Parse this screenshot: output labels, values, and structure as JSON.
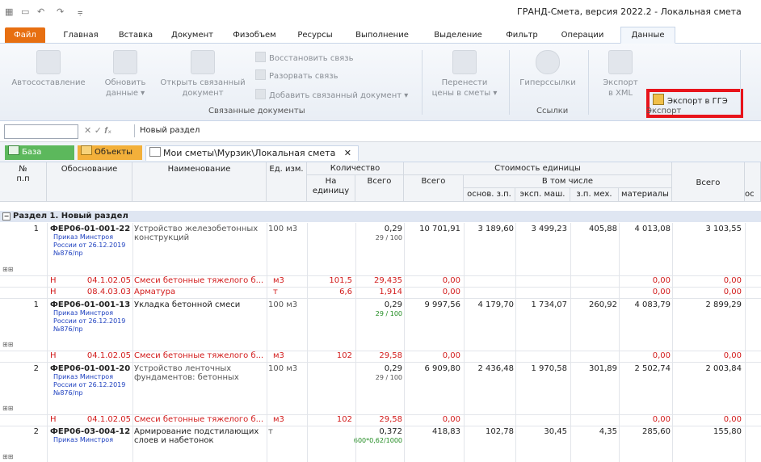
{
  "titlebar": {
    "app_title": "ГРАНД-Смета, версия 2022.2 - Локальная смета",
    "quick_access": [
      "app-icon",
      "save-icon",
      "undo-icon",
      "redo-icon",
      "customize-icon"
    ]
  },
  "tabs": [
    "Файл",
    "Главная",
    "Вставка",
    "Документ",
    "Физобъем",
    "Ресурсы",
    "Выполнение",
    "Выделение",
    "Фильтр",
    "Операции",
    "Данные"
  ],
  "active_tab": "Данные",
  "ribbon": {
    "autosostavlenie": "Автосоставление",
    "obnovit": [
      "Обновить",
      "данные ▾"
    ],
    "otkryt": [
      "Открыть связанный",
      "документ"
    ],
    "restore_link": "Восстановить связь",
    "break_link": "Разорвать связь",
    "add_linked": "Добавить связанный документ ▾",
    "group_linked": "Связанные документы",
    "move_prices": [
      "Перенести",
      "цены в сметы ▾"
    ],
    "hyperlinks": "Гиперссылки",
    "group_links": "Ссылки",
    "export_xml": [
      "Экспорт",
      "в XML"
    ],
    "export_gge": "Экспорт в ГГЭ",
    "group_export": "Экспорт"
  },
  "formula_bar": {
    "name_box": "",
    "icons": "✕ ✓ 𝒇ₓ",
    "text": "Новый раздел"
  },
  "doc_tabs": {
    "base": "База",
    "objects": "Объекты",
    "current": "Мои сметы\\Мурзик\\Локальная смета",
    "close": "✕"
  },
  "headers": {
    "num": "№\nп.п",
    "basis": "Обоснование",
    "name": "Наименование",
    "unit": "Ед. изм.",
    "qty": "Количество",
    "qty_per": "На единицу",
    "qty_total": "Всего",
    "unit_cost": "Стоимость единицы",
    "uc_total": "Всего",
    "incl": "В том числе",
    "osn_zp": "основ. з.п.",
    "eksp_mash": "эксп. маш.",
    "zp_meh": "з.п. мех.",
    "materials": "материалы",
    "total2": "Всего",
    "os": "ос"
  },
  "section": "Раздел 1. Новый раздел",
  "rows": [
    {
      "kind": "main",
      "num": "1",
      "code": "ФЕР06-01-001-22",
      "order": [
        "Приказ Минстроя",
        "России от 26.12.2019",
        "№876/пр"
      ],
      "name": [
        "Устройство железобетонных",
        "конструкций"
      ],
      "unit": "100 м3",
      "qty": "0,29",
      "qty_sub": "29 / 100",
      "qty_sub_color": "gry",
      "total": "10 701,91",
      "osn": "3 189,60",
      "eksp": "3 499,23",
      "zpm": "405,88",
      "mat": "4 013,08",
      "tot2": "3 103,55",
      "name_gray": true
    },
    {
      "kind": "res",
      "code": "04.1.02.05",
      "name": "Смеси бетонные тяжелого б...",
      "unit": "м3",
      "per": "101,5",
      "qty": "29,435",
      "total": "0,00",
      "mat": "0,00",
      "tot2": "0,00"
    },
    {
      "kind": "res",
      "code": "08.4.03.03",
      "name": "Арматура",
      "unit": "т",
      "per": "6,6",
      "qty": "1,914",
      "total": "0,00",
      "mat": "0,00",
      "tot2": "0,00"
    },
    {
      "kind": "main",
      "num": "1",
      "code": "ФЕР06-01-001-13",
      "order": [
        "Приказ Минстроя",
        "России от 26.12.2019",
        "№876/пр"
      ],
      "name": [
        "Укладка бетонной смеси"
      ],
      "unit": "100 м3",
      "qty": "0,29",
      "qty_sub": "29 / 100",
      "qty_sub_color": "grn",
      "total": "9 997,56",
      "osn": "4 179,70",
      "eksp": "1 734,07",
      "zpm": "260,92",
      "mat": "4 083,79",
      "tot2": "2 899,29",
      "name_gray": false
    },
    {
      "kind": "res",
      "code": "04.1.02.05",
      "name": "Смеси бетонные тяжелого б...",
      "unit": "м3",
      "per": "102",
      "qty": "29,58",
      "total": "0,00",
      "mat": "0,00",
      "tot2": "0,00"
    },
    {
      "kind": "main",
      "num": "2",
      "code": "ФЕР06-01-001-20",
      "order": [
        "Приказ Минстроя",
        "России от 26.12.2019",
        "№876/пр"
      ],
      "name": [
        "Устройство ленточных",
        "фундаментов: бетонных"
      ],
      "unit": "100 м3",
      "qty": "0,29",
      "qty_sub": "29 / 100",
      "qty_sub_color": "gry",
      "total": "6 909,80",
      "osn": "2 436,48",
      "eksp": "1 970,58",
      "zpm": "301,89",
      "mat": "2 502,74",
      "tot2": "2 003,84",
      "name_gray": true
    },
    {
      "kind": "res",
      "code": "04.1.02.05",
      "name": "Смеси бетонные тяжелого б...",
      "unit": "м3",
      "per": "102",
      "qty": "29,58",
      "total": "0,00",
      "mat": "0,00",
      "tot2": "0,00"
    },
    {
      "kind": "main",
      "num": "2",
      "code": "ФЕР06-03-004-12",
      "order": [
        "Приказ Минстроя"
      ],
      "name": [
        "Армирование подстилающих",
        "слоев и набетонок"
      ],
      "unit": "т",
      "qty": "0,372",
      "qty_sub": "600*0,62/1000",
      "qty_sub_color": "grn",
      "total": "418,83",
      "osn": "102,78",
      "eksp": "30,45",
      "zpm": "4,35",
      "mat": "285,60",
      "tot2": "155,80",
      "name_gray": false
    }
  ],
  "res_prefix": "Н",
  "expand_icons": "⊞⊞"
}
